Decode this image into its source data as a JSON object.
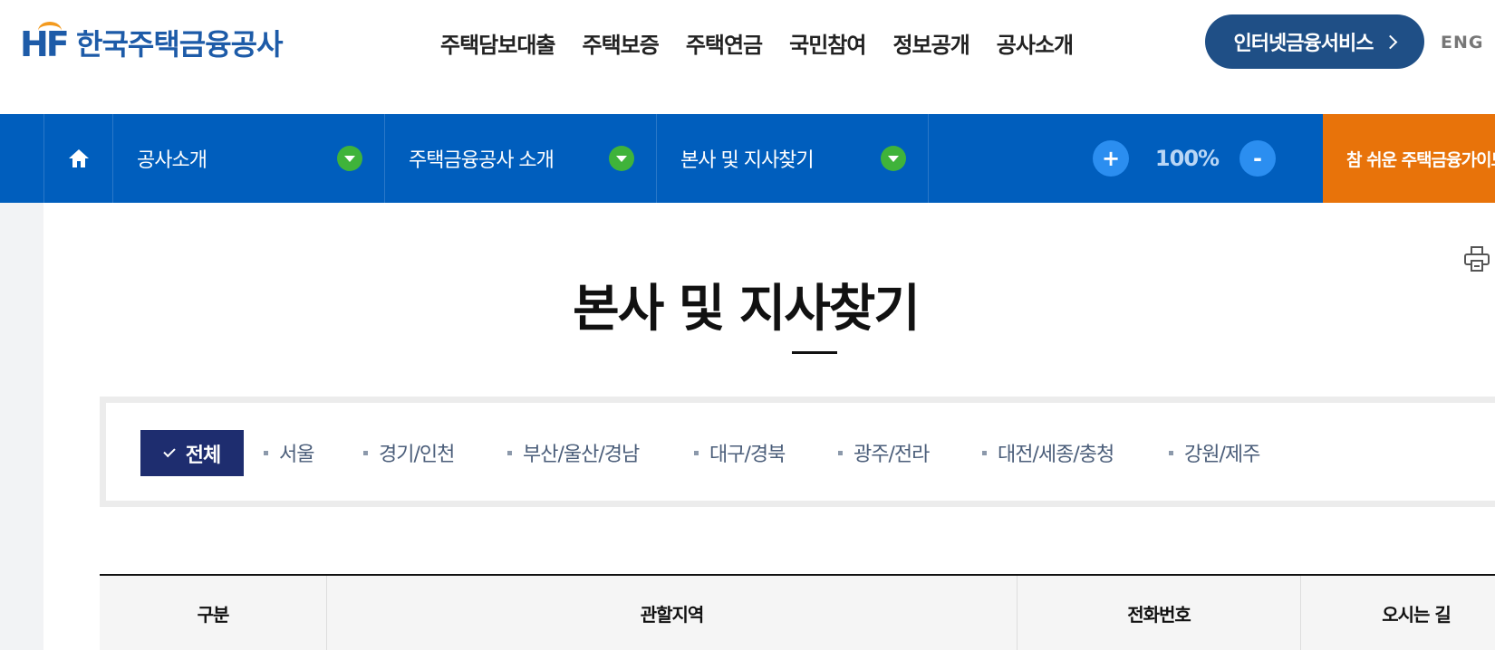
{
  "header": {
    "logo_mark": "HF",
    "logo_text": "한국주택금융공사",
    "gnb": [
      "주택담보대출",
      "주택보증",
      "주택연금",
      "국민참여",
      "정보공개",
      "공사소개"
    ],
    "service_button": "인터넷금융서비스",
    "lang": "ENG"
  },
  "locbar": {
    "home_icon": "home-icon",
    "dropdowns": [
      "공사소개",
      "주택금융공사 소개",
      "본사 및 지사찾기"
    ],
    "zoom_plus": "+",
    "zoom_value": "100%",
    "zoom_minus": "-",
    "promo_text": "참 쉬운 주택금융가이드"
  },
  "page": {
    "title": "본사 및 지사찾기",
    "print_icon": "print-icon"
  },
  "region_tabs": {
    "active": "전체",
    "items": [
      "서울",
      "경기/인천",
      "부산/울산/경남",
      "대구/경북",
      "광주/전라",
      "대전/세종/충청",
      "강원/제주"
    ]
  },
  "table": {
    "headers": [
      "구분",
      "관할지역",
      "전화번호",
      "오시는 길"
    ]
  },
  "colors": {
    "brand_blue": "#1d5ba8",
    "locbar_blue": "#005ebd",
    "service_navy": "#1f4f86",
    "accent_green": "#3fb33a",
    "promo_orange": "#e8730a",
    "active_tab_navy": "#1e2d6f"
  }
}
